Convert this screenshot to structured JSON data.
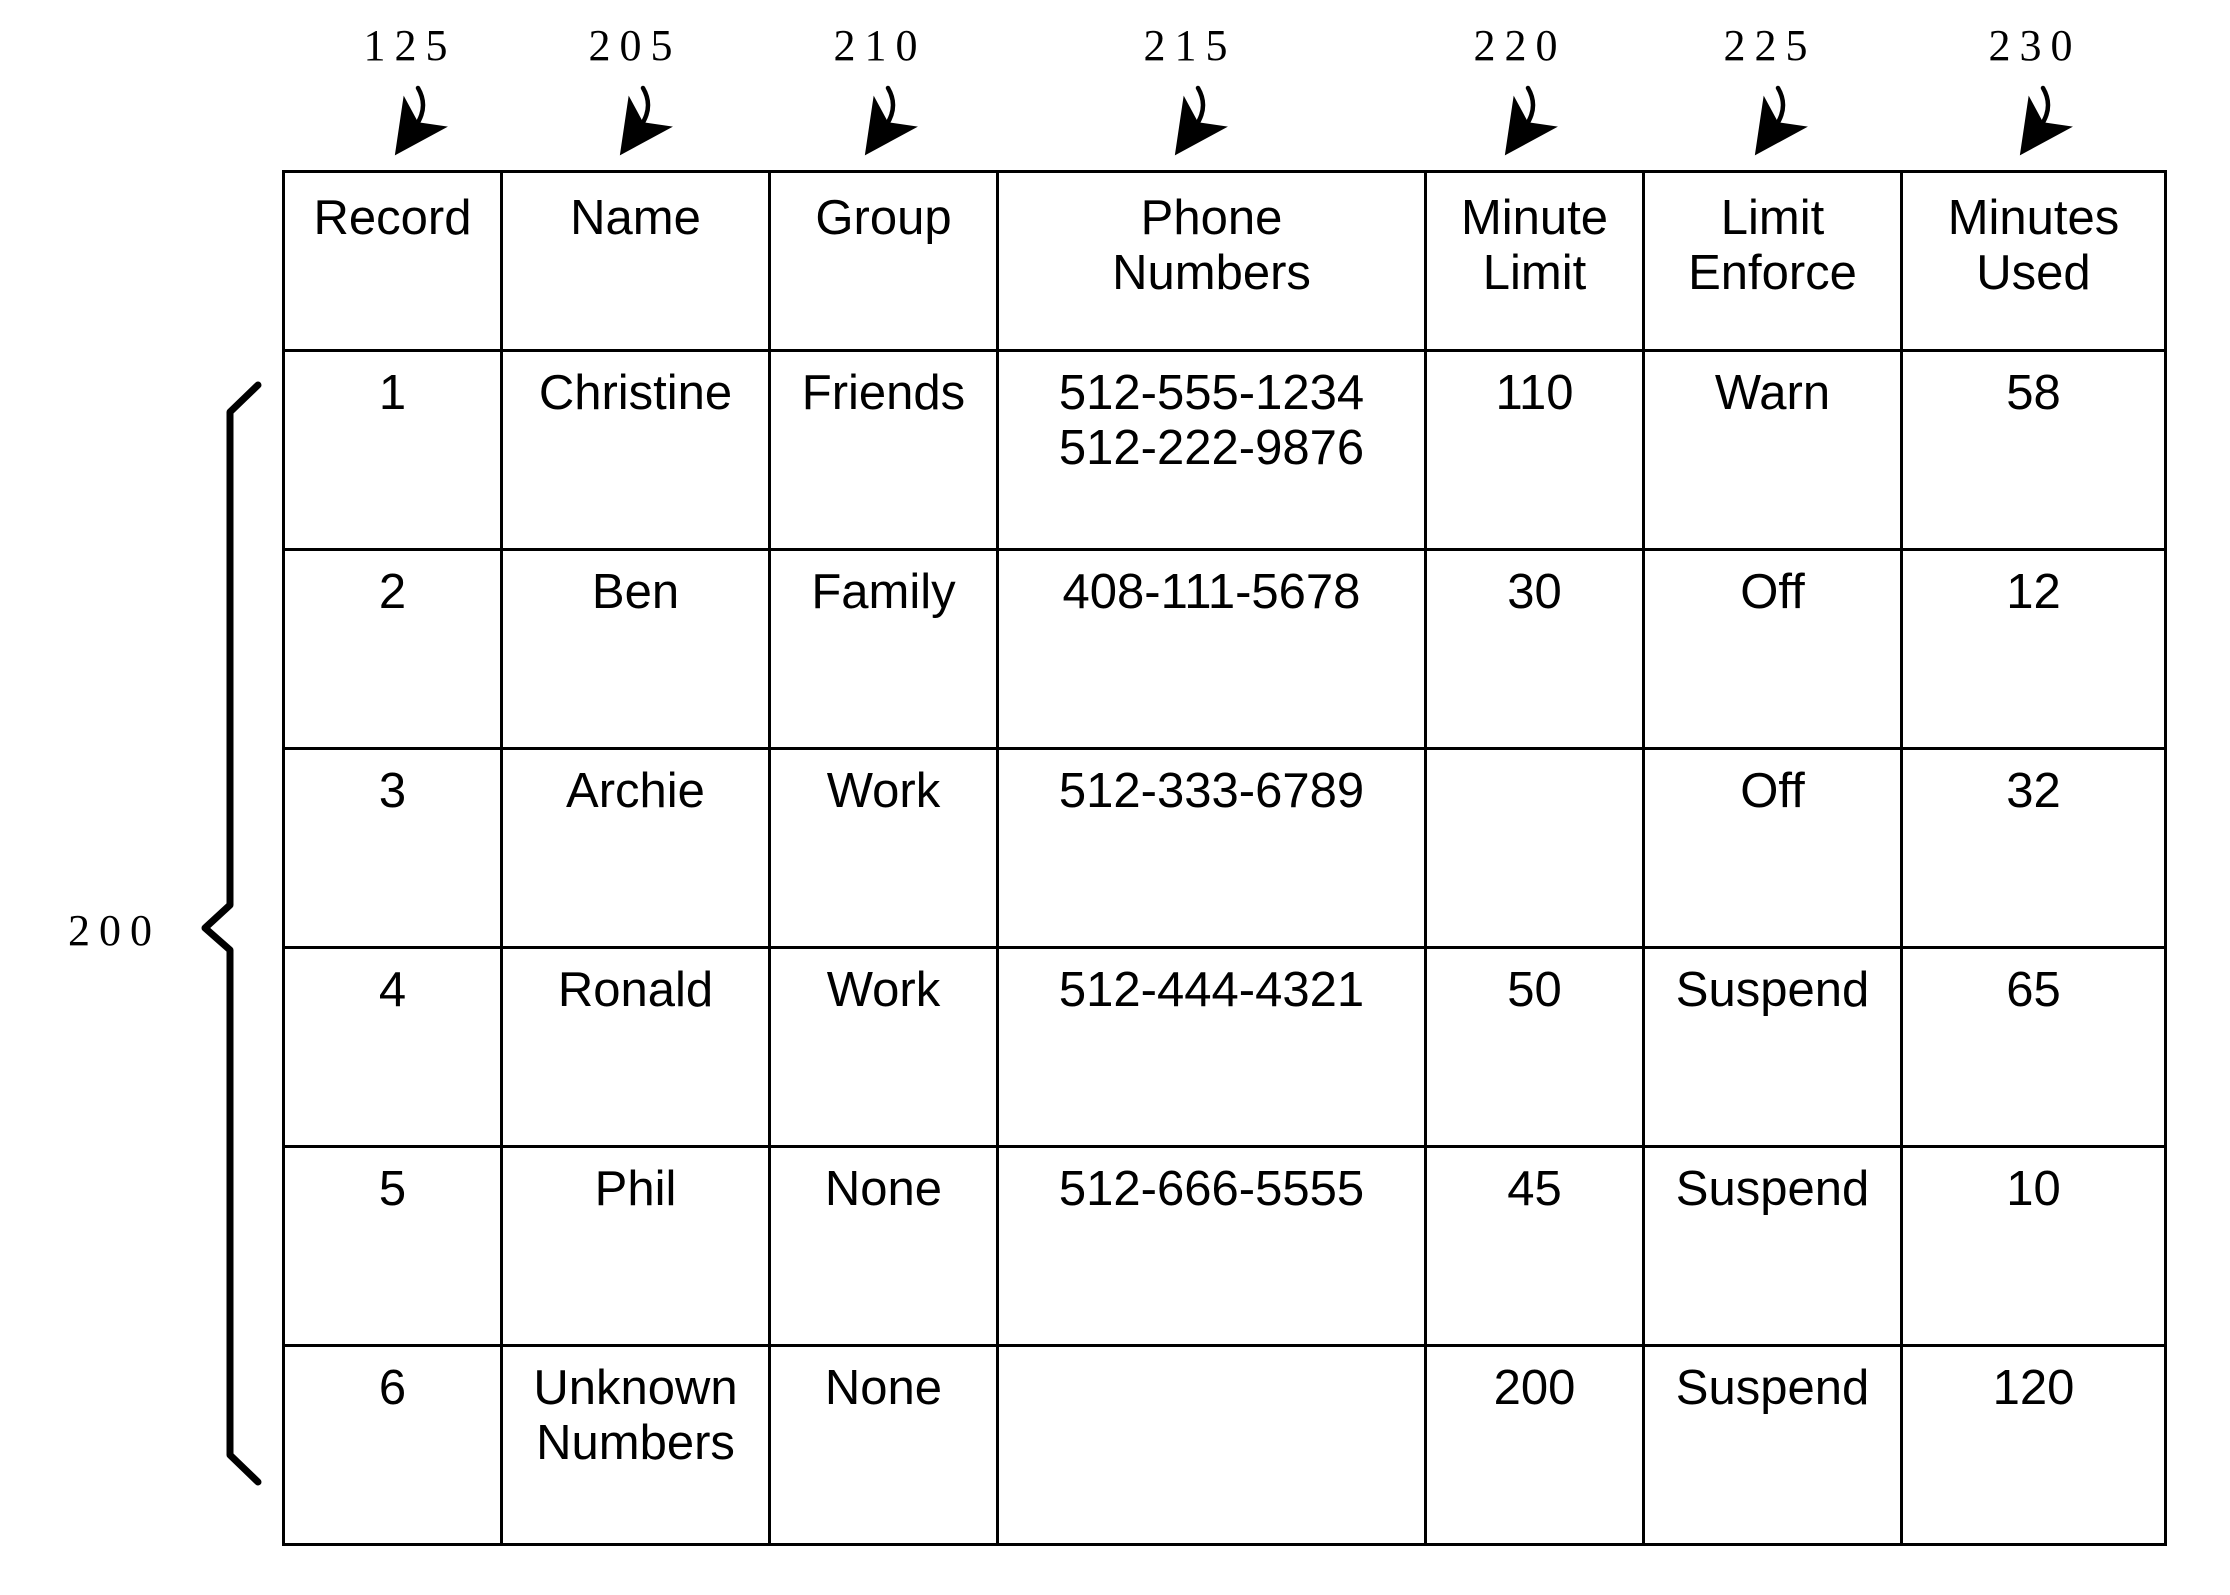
{
  "figure": {
    "table_reference_numeral": "200",
    "column_callouts": [
      "125",
      "205",
      "210",
      "215",
      "220",
      "225",
      "230"
    ]
  },
  "table": {
    "headers": [
      {
        "lines": [
          "Record"
        ]
      },
      {
        "lines": [
          "Name"
        ]
      },
      {
        "lines": [
          "Group"
        ]
      },
      {
        "lines": [
          "Phone",
          "Numbers"
        ]
      },
      {
        "lines": [
          "Minute",
          "Limit"
        ]
      },
      {
        "lines": [
          "Limit",
          "Enforce"
        ]
      },
      {
        "lines": [
          "Minutes",
          "Used"
        ]
      }
    ],
    "rows": [
      {
        "record": "1",
        "name": [
          "Christine"
        ],
        "group": "Friends",
        "phone_numbers": [
          "512-555-1234",
          "512-222-9876"
        ],
        "minute_limit": "110",
        "limit_enforce": "Warn",
        "minutes_used": "58"
      },
      {
        "record": "2",
        "name": [
          "Ben"
        ],
        "group": "Family",
        "phone_numbers": [
          "408-111-5678"
        ],
        "minute_limit": "30",
        "limit_enforce": "Off",
        "minutes_used": "12"
      },
      {
        "record": "3",
        "name": [
          "Archie"
        ],
        "group": "Work",
        "phone_numbers": [
          "512-333-6789"
        ],
        "minute_limit": "",
        "limit_enforce": "Off",
        "minutes_used": "32"
      },
      {
        "record": "4",
        "name": [
          "Ronald"
        ],
        "group": "Work",
        "phone_numbers": [
          "512-444-4321"
        ],
        "minute_limit": "50",
        "limit_enforce": "Suspend",
        "minutes_used": "65"
      },
      {
        "record": "5",
        "name": [
          "Phil"
        ],
        "group": "None",
        "phone_numbers": [
          "512-666-5555"
        ],
        "minute_limit": "45",
        "limit_enforce": "Suspend",
        "minutes_used": "10"
      },
      {
        "record": "6",
        "name": [
          "Unknown",
          "Numbers"
        ],
        "group": "None",
        "phone_numbers": [],
        "minute_limit": "200",
        "limit_enforce": "Suspend",
        "minutes_used": "120"
      }
    ]
  },
  "colors": {
    "ink": "#000000",
    "paper": "#ffffff"
  }
}
